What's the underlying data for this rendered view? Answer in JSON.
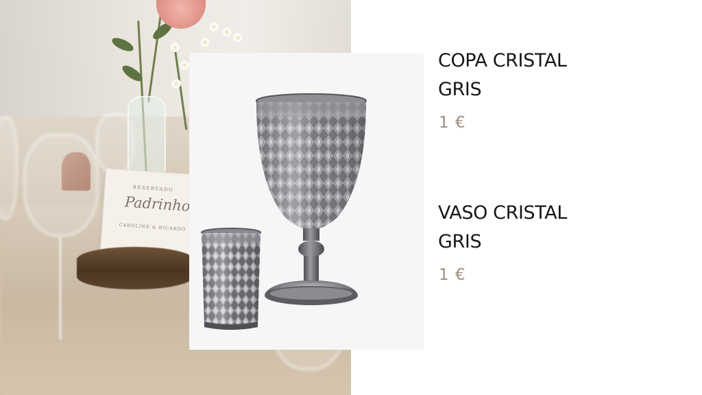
{
  "products": [
    {
      "name": "COPA CRISTAL\nGRIS",
      "price": "1 €"
    },
    {
      "name": "VASO CRISTAL\nGRIS",
      "price": "1 €"
    }
  ],
  "background_photo": {
    "place_card_title": "RESERVADO",
    "place_card_script": "Padrinhos",
    "place_card_names": "CAROLINE & RICARDO"
  },
  "colors": {
    "title": "#161616",
    "price": "#9c8d81",
    "glass": "#7a7a80",
    "product_bg": "#f6f6f6"
  }
}
